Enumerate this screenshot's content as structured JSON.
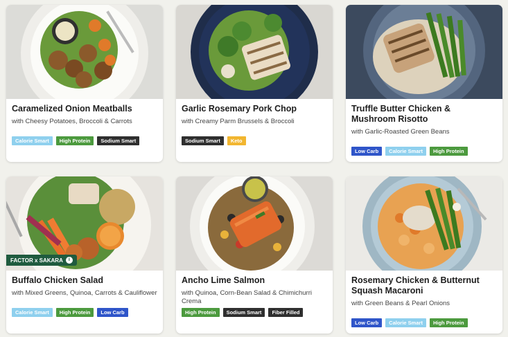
{
  "colors": {
    "calorie_smart": "#8fd0ee",
    "high_protein": "#4c9a3e",
    "sodium_smart": "#2f2f2f",
    "keto": "#f2b630",
    "low_carb": "#2f55c9",
    "fiber_filled": "#2f2f2f",
    "badge": "#1f5b3f"
  },
  "meals": [
    {
      "title": "Caramelized Onion Meatballs",
      "subtitle": "with Cheesy Potatoes, Broccoli & Carrots",
      "tags": [
        "Calorie Smart",
        "High Protein",
        "Sodium Smart"
      ]
    },
    {
      "title": "Garlic Rosemary Pork Chop",
      "subtitle": "with Creamy Parm Brussels & Broccoli",
      "tags": [
        "Sodium Smart",
        "Keto"
      ]
    },
    {
      "title": "Truffle Butter Chicken & Mushroom Risotto",
      "subtitle": "with Garlic-Roasted Green Beans",
      "tags": [
        "Low Carb",
        "Calorie Smart",
        "High Protein"
      ]
    },
    {
      "title": "Buffalo Chicken Salad",
      "subtitle": "with Mixed Greens, Quinoa, Carrots & Cauliflower",
      "tags": [
        "Calorie Smart",
        "High Protein",
        "Low Carb"
      ],
      "badge": "FACTOR x SAKARA",
      "badge_icon": "info-icon"
    },
    {
      "title": "Ancho Lime Salmon",
      "subtitle": "with Quinoa, Corn-Bean Salad & Chimichurri Crema",
      "tags": [
        "High Protein",
        "Sodium Smart",
        "Fiber Filled"
      ]
    },
    {
      "title": "Rosemary Chicken & Butternut Squash Macaroni",
      "subtitle": "with Green Beans & Pearl Onions",
      "tags": [
        "Low Carb",
        "Calorie Smart",
        "High Protein"
      ]
    }
  ]
}
